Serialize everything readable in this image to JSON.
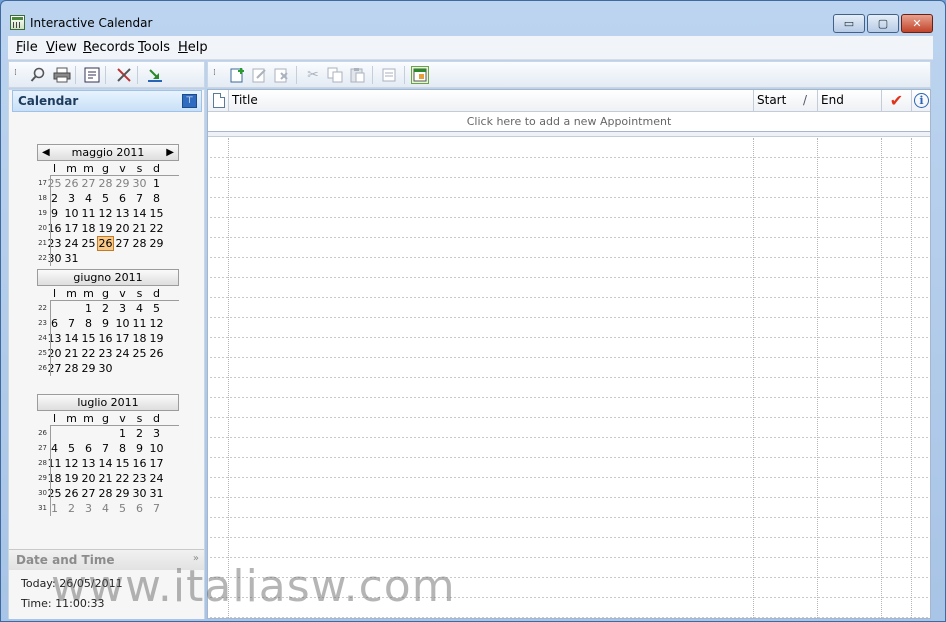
{
  "window": {
    "title": "Interactive Calendar",
    "minimize": "▭",
    "maximize": "▢",
    "close": "✕"
  },
  "menu": [
    "File",
    "View",
    "Records",
    "Tools",
    "Help"
  ],
  "left_toolbar": {
    "icons": [
      "find-icon",
      "print-icon",
      "report-icon",
      "settings-icon",
      "export-icon"
    ]
  },
  "calendar_pane": {
    "title": "Calendar",
    "pin": "📌",
    "day_headers": [
      "l",
      "m",
      "m",
      "g",
      "v",
      "s",
      "d"
    ],
    "months": [
      {
        "title": "maggio 2011",
        "has_nav": true,
        "weeks": [
          {
            "wk": "17",
            "days": [
              {
                "d": "25",
                "o": true
              },
              {
                "d": "26",
                "o": true
              },
              {
                "d": "27",
                "o": true
              },
              {
                "d": "28",
                "o": true
              },
              {
                "d": "29",
                "o": true
              },
              {
                "d": "30",
                "o": true
              },
              {
                "d": "1"
              }
            ]
          },
          {
            "wk": "18",
            "days": [
              {
                "d": "2"
              },
              {
                "d": "3"
              },
              {
                "d": "4"
              },
              {
                "d": "5"
              },
              {
                "d": "6"
              },
              {
                "d": "7"
              },
              {
                "d": "8"
              }
            ]
          },
          {
            "wk": "19",
            "days": [
              {
                "d": "9"
              },
              {
                "d": "10"
              },
              {
                "d": "11"
              },
              {
                "d": "12"
              },
              {
                "d": "13"
              },
              {
                "d": "14"
              },
              {
                "d": "15"
              }
            ]
          },
          {
            "wk": "20",
            "days": [
              {
                "d": "16"
              },
              {
                "d": "17"
              },
              {
                "d": "18"
              },
              {
                "d": "19"
              },
              {
                "d": "20"
              },
              {
                "d": "21"
              },
              {
                "d": "22"
              }
            ]
          },
          {
            "wk": "21",
            "days": [
              {
                "d": "23"
              },
              {
                "d": "24"
              },
              {
                "d": "25"
              },
              {
                "d": "26",
                "t": true
              },
              {
                "d": "27"
              },
              {
                "d": "28"
              },
              {
                "d": "29"
              }
            ]
          },
          {
            "wk": "22",
            "days": [
              {
                "d": "30"
              },
              {
                "d": "31"
              }
            ]
          }
        ]
      },
      {
        "title": "giugno 2011",
        "has_nav": false,
        "weeks": [
          {
            "wk": "22",
            "days": [
              {
                "d": ""
              },
              {
                "d": ""
              },
              {
                "d": "1"
              },
              {
                "d": "2"
              },
              {
                "d": "3"
              },
              {
                "d": "4"
              },
              {
                "d": "5"
              }
            ]
          },
          {
            "wk": "23",
            "days": [
              {
                "d": "6"
              },
              {
                "d": "7"
              },
              {
                "d": "8"
              },
              {
                "d": "9"
              },
              {
                "d": "10"
              },
              {
                "d": "11"
              },
              {
                "d": "12"
              }
            ]
          },
          {
            "wk": "24",
            "days": [
              {
                "d": "13"
              },
              {
                "d": "14"
              },
              {
                "d": "15"
              },
              {
                "d": "16"
              },
              {
                "d": "17"
              },
              {
                "d": "18"
              },
              {
                "d": "19"
              }
            ]
          },
          {
            "wk": "25",
            "days": [
              {
                "d": "20"
              },
              {
                "d": "21"
              },
              {
                "d": "22"
              },
              {
                "d": "23"
              },
              {
                "d": "24"
              },
              {
                "d": "25"
              },
              {
                "d": "26"
              }
            ]
          },
          {
            "wk": "26",
            "days": [
              {
                "d": "27"
              },
              {
                "d": "28"
              },
              {
                "d": "29"
              },
              {
                "d": "30"
              }
            ]
          }
        ]
      },
      {
        "title": "luglio 2011",
        "has_nav": false,
        "weeks": [
          {
            "wk": "26",
            "days": [
              {
                "d": ""
              },
              {
                "d": ""
              },
              {
                "d": ""
              },
              {
                "d": ""
              },
              {
                "d": "1"
              },
              {
                "d": "2"
              },
              {
                "d": "3"
              }
            ]
          },
          {
            "wk": "27",
            "days": [
              {
                "d": "4"
              },
              {
                "d": "5"
              },
              {
                "d": "6"
              },
              {
                "d": "7"
              },
              {
                "d": "8"
              },
              {
                "d": "9"
              },
              {
                "d": "10"
              }
            ]
          },
          {
            "wk": "28",
            "days": [
              {
                "d": "11"
              },
              {
                "d": "12"
              },
              {
                "d": "13"
              },
              {
                "d": "14"
              },
              {
                "d": "15"
              },
              {
                "d": "16"
              },
              {
                "d": "17"
              }
            ]
          },
          {
            "wk": "29",
            "days": [
              {
                "d": "18"
              },
              {
                "d": "19"
              },
              {
                "d": "20"
              },
              {
                "d": "21"
              },
              {
                "d": "22"
              },
              {
                "d": "23"
              },
              {
                "d": "24"
              }
            ]
          },
          {
            "wk": "30",
            "days": [
              {
                "d": "25"
              },
              {
                "d": "26"
              },
              {
                "d": "27"
              },
              {
                "d": "28"
              },
              {
                "d": "29"
              },
              {
                "d": "30"
              },
              {
                "d": "31"
              }
            ]
          },
          {
            "wk": "31",
            "days": [
              {
                "d": "1",
                "o": true
              },
              {
                "d": "2",
                "o": true
              },
              {
                "d": "3",
                "o": true
              },
              {
                "d": "4",
                "o": true
              },
              {
                "d": "5",
                "o": true
              },
              {
                "d": "6",
                "o": true
              },
              {
                "d": "7",
                "o": true
              }
            ]
          }
        ]
      }
    ]
  },
  "date_time": {
    "title": "Date and Time",
    "today": "Today: 26/05/2011",
    "time": "Time: 11:00:33"
  },
  "right_toolbar": {
    "icons": [
      {
        "name": "new-appointment-icon",
        "enabled": true
      },
      {
        "name": "edit-appointment-icon",
        "enabled": false
      },
      {
        "name": "delete-appointment-icon",
        "enabled": false
      },
      {
        "name": "cut-icon",
        "enabled": false
      },
      {
        "name": "copy-icon",
        "enabled": false
      },
      {
        "name": "paste-icon",
        "enabled": false
      },
      {
        "name": "properties-icon",
        "enabled": false
      },
      {
        "name": "calendar-view-icon",
        "enabled": true
      }
    ]
  },
  "grid": {
    "columns": {
      "title": "Title",
      "start": "Start",
      "sort_indicator": "/",
      "end": "End"
    },
    "add_row": "Click here to add a new Appointment"
  },
  "watermark": "www.italiasw.com",
  "colors": {
    "today_highlight": "#f9c98a",
    "check": "#e0331b",
    "info": "#2a64b8",
    "pane_header": "#c8e0f7"
  }
}
